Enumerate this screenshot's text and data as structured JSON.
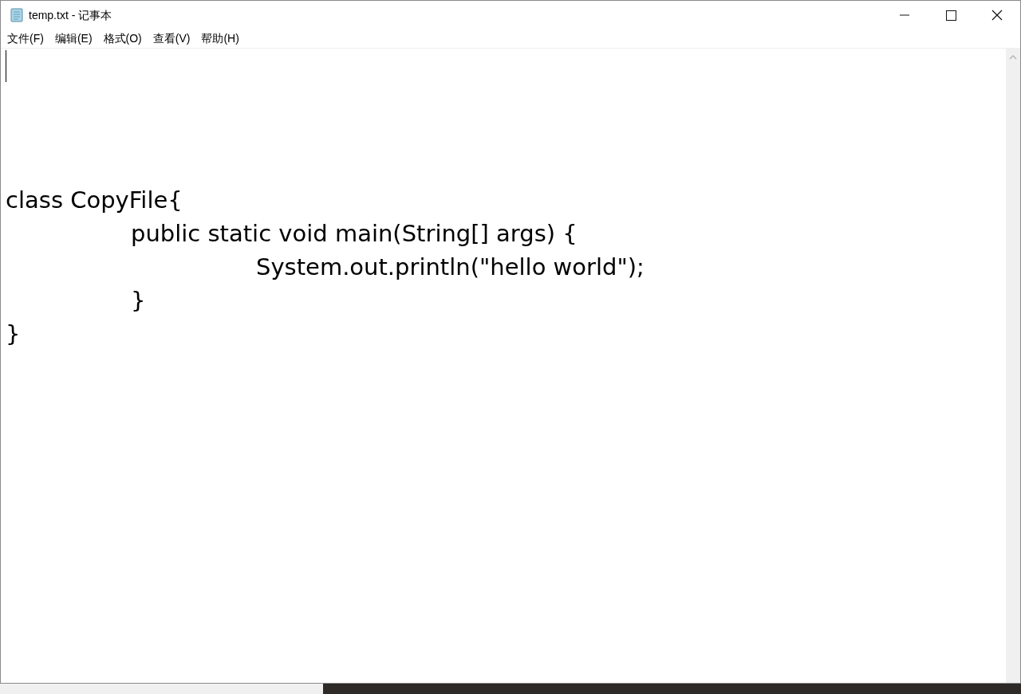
{
  "window": {
    "title": "temp.txt - 记事本"
  },
  "menu": [
    {
      "label": "文件(F)"
    },
    {
      "label": "编辑(E)"
    },
    {
      "label": "格式(O)"
    },
    {
      "label": "查看(V)"
    },
    {
      "label": "帮助(H)"
    }
  ],
  "editor": {
    "text": "\n\n\n\nclass CopyFile{\n\tpublic static void main(String[] args) {\n\t\tSystem.out.println(\"hello world\");\n\t}\n}"
  }
}
